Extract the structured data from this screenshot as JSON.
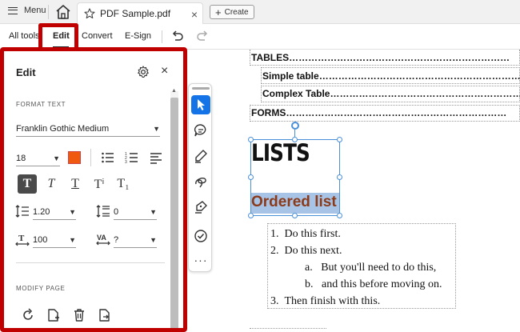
{
  "topbar": {
    "menu_label": "Menu",
    "tab_title": "PDF Sample.pdf",
    "tab_close": "×",
    "create_label": "Create",
    "create_plus": "+"
  },
  "toolbar": {
    "tabs": [
      {
        "label": "All tools",
        "active": false
      },
      {
        "label": "Edit",
        "active": true
      },
      {
        "label": "Convert",
        "active": false
      },
      {
        "label": "E-Sign",
        "active": false
      }
    ]
  },
  "panel": {
    "title": "Edit",
    "close_glyph": "×",
    "format_text_label": "FORMAT TEXT",
    "font_family_value": "Franklin Gothic Medium",
    "font_size_value": "18",
    "text_color": "#f05a10",
    "text_styles": [
      {
        "glyph": "T",
        "name": "bold",
        "selected": true
      },
      {
        "glyph": "T",
        "name": "italic",
        "selected": false
      },
      {
        "glyph": "T",
        "name": "underline",
        "selected": false
      },
      {
        "glyph": "Tⁱ",
        "name": "superscript",
        "selected": false
      },
      {
        "glyph": "T₁",
        "name": "subscript",
        "selected": false
      }
    ],
    "line_spacing_value": "1.20",
    "paragraph_spacing_value": "0",
    "horizontal_scale_value": "100",
    "char_spacing_value": "?",
    "modify_page_label": "MODIFY PAGE"
  },
  "rail": {
    "active_tool": "select",
    "more_glyph": "···"
  },
  "document": {
    "toc": [
      {
        "label": "TABLES",
        "level": 0
      },
      {
        "label": "Simple table",
        "level": 1
      },
      {
        "label": "Complex Table",
        "level": 1
      },
      {
        "label": "FORMS",
        "level": 0
      }
    ],
    "heading": "LISTS",
    "subheading": "Ordered list",
    "list_items": [
      {
        "marker": "1.",
        "text": "Do this first.",
        "indent": 0
      },
      {
        "marker": "2.",
        "text": "Do this next.",
        "indent": 0
      },
      {
        "marker": "a.",
        "text": "But you'll need to do this,",
        "indent": 1
      },
      {
        "marker": "b.",
        "text": "and this before moving on.",
        "indent": 1
      },
      {
        "marker": "3.",
        "text": "Then finish with this.",
        "indent": 0
      }
    ]
  },
  "colors": {
    "highlight_red": "#c00000",
    "accent_blue": "#1473e6",
    "subheading_color": "#8b3a1a"
  }
}
